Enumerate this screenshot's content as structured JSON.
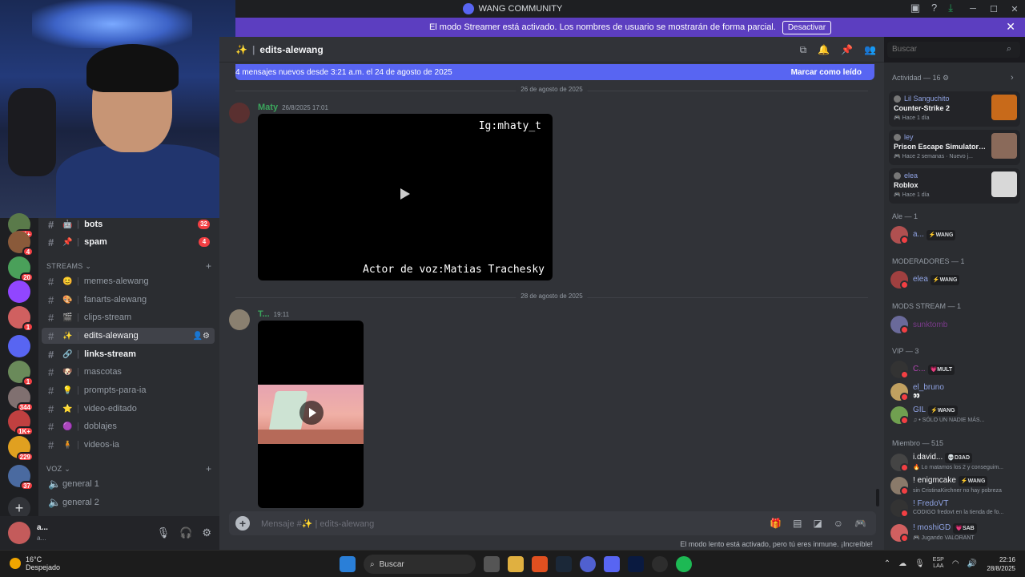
{
  "window": {
    "title": "WANG COMMUNITY"
  },
  "banner": {
    "text": "El modo Streamer está activado. Los nombres de usuario se mostrarán de forma parcial.",
    "button": "Desactivar"
  },
  "servers": [
    {
      "badge": "1K+",
      "color": "#5a7a4a"
    },
    {
      "badge": "4",
      "color": "#8a5a3a"
    },
    {
      "badge": "20",
      "color": "#4aa05a"
    },
    {
      "badge": "",
      "color": "#9146ff"
    },
    {
      "badge": "1",
      "color": "#d06060"
    },
    {
      "badge": "",
      "color": "#5865f2"
    },
    {
      "badge": "1",
      "color": "#6a8a5a"
    },
    {
      "badge": "344",
      "color": "#807070"
    },
    {
      "badge": "1K+",
      "color": "#c04040"
    },
    {
      "badge": "229",
      "color": "#e0a020"
    },
    {
      "badge": "37",
      "color": "#4a6aa0"
    }
  ],
  "channels": {
    "items": [
      {
        "emoji": "🤖",
        "name": "bots",
        "badge": "32",
        "unread": true
      },
      {
        "emoji": "📌",
        "name": "spam",
        "badge": "4",
        "unread": true
      },
      {
        "emoji": "😊",
        "name": "memes-alewang"
      },
      {
        "emoji": "🎨",
        "name": "fanarts-alewang"
      },
      {
        "emoji": "🎬",
        "name": "clips-stream"
      },
      {
        "emoji": "✨",
        "name": "edits-alewang",
        "active": true
      },
      {
        "emoji": "🔗",
        "name": "links-stream",
        "unread": true
      },
      {
        "emoji": "🐶",
        "name": "mascotas"
      },
      {
        "emoji": "💡",
        "name": "prompts-para-ia"
      },
      {
        "emoji": "⭐",
        "name": "video-editado"
      },
      {
        "emoji": "🟣",
        "name": "doblajes"
      },
      {
        "emoji": "🧍",
        "name": "videos-ia"
      }
    ],
    "category_streams": "STREAMS",
    "category_voz": "VOZ",
    "voice": [
      {
        "name": "general 1"
      },
      {
        "name": "general 2"
      }
    ]
  },
  "user": {
    "name": "a...",
    "status": "a..."
  },
  "header": {
    "channel": "edits-alewang",
    "emoji": "✨"
  },
  "newbar": {
    "text": "4 mensajes nuevos desde 3:21 a.m. el 24 de agosto de 2025",
    "mark": "Marcar como leído"
  },
  "messages": {
    "date1": "26 de agosto de 2025",
    "msg1": {
      "author": "Maty",
      "time": "26/8/2025 17:01",
      "video_top": "Ig:mhaty_t",
      "video_bottom": "Actor de voz:Matias Trachesky"
    },
    "date2": "28 de agosto de 2025",
    "msg2": {
      "author": "T...",
      "time": "19:11"
    }
  },
  "composer": {
    "placeholder": "Mensaje #✨ | edits-alewang",
    "slowmode": "El modo lento está activado, pero tú eres inmune. ¡Increíble!"
  },
  "search": {
    "placeholder": "Buscar"
  },
  "members": {
    "activity_title": "Actividad — 16",
    "activities": [
      {
        "who": "Lil Sanguchito",
        "game": "Counter-Strike 2",
        "ago": "🎮 Hace 1 día",
        "art": "#c86a1a"
      },
      {
        "who": "ley",
        "game": "Prison Escape Simulator: D...",
        "ago": "🎮 Hace 2 semanas · Nuevo j...",
        "art": "#8a6a5a"
      },
      {
        "who": "elea",
        "game": "Roblox",
        "ago": "🎮 Hace 1 día",
        "art": "#d8d8d8"
      }
    ],
    "ale_title": "Ale — 1",
    "ale": [
      {
        "name": "a...",
        "tag": "⚡WANG",
        "color": "#8ea1e1",
        "av": "#b05050"
      }
    ],
    "mod_title": "MODERADORES — 1",
    "mods": [
      {
        "name": "elea",
        "tag": "⚡WANG",
        "color": "#8ea1e1",
        "av": "#a04040"
      }
    ],
    "modstream_title": "MODS STREAM — 1",
    "modstream": [
      {
        "name": "sunktomb",
        "color": "#7a3a8a",
        "av": "#6a6a9a"
      }
    ],
    "vip_title": "VIP — 3",
    "vip": [
      {
        "name": "C...",
        "tag": "💗MULT",
        "color": "#b044b0",
        "av": "#333"
      },
      {
        "name": "el_bruno",
        "sub": "👀",
        "color": "#8ea1e1",
        "av": "#c0a060"
      },
      {
        "name": "GIL",
        "tag": "⚡WANG",
        "sub": "♫ • SÓLO UN NADIE MÁS...",
        "color": "#8ea1e1",
        "av": "#70a050"
      }
    ],
    "member_title": "Miembro — 515",
    "member": [
      {
        "name": "i.david...",
        "tag": "💀D3AD",
        "sub": "🔥 Lo matamos los 2 y conseguim...",
        "color": "#f2f3f5",
        "av": "#444"
      },
      {
        "name": "! enigmcake",
        "tag": "⚡WANG",
        "sub": "sin CristinaKirchner no hay pobreza",
        "color": "#f2f3f5",
        "av": "#8a7a6a"
      },
      {
        "name": "! FredoVT",
        "sub": "CODIGO fredovt en la tienda de fo...",
        "color": "#8ea1e1",
        "av": "#333"
      },
      {
        "name": "! moshiGD",
        "tag": "💗SAB",
        "sub": "🎮 Jugando VALORANT",
        "color": "#8ea1e1",
        "av": "#d06060"
      }
    ]
  },
  "taskbar": {
    "temp": "16°C",
    "weather": "Despejado",
    "search": "Buscar",
    "lang1": "ESP",
    "lang2": "LAA",
    "time": "22:16",
    "date": "28/8/2025"
  },
  "colors": {
    "accent": "#5865f2",
    "banner": "#5c3ec0"
  }
}
